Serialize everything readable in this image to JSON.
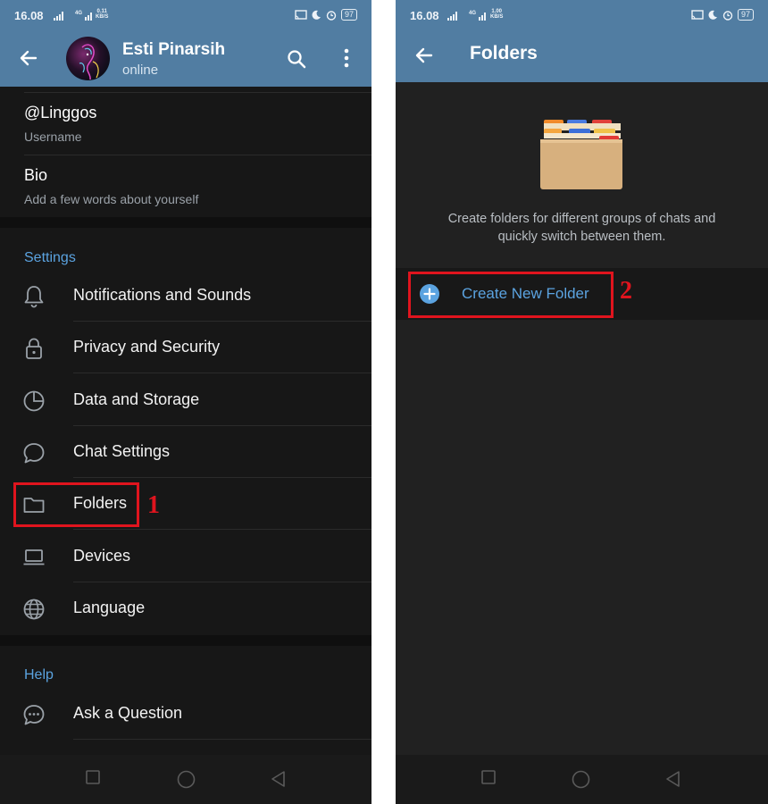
{
  "left": {
    "status": {
      "time": "16.08",
      "network": "4G",
      "speed_value": "0.11",
      "speed_unit": "KB/S",
      "battery": "97"
    },
    "header": {
      "name": "Esti Pinarsih",
      "status": "online"
    },
    "profile": {
      "username_value": "@Linggos",
      "username_label": "Username",
      "bio_value": "Bio",
      "bio_hint": "Add a few words about yourself"
    },
    "settings": {
      "title": "Settings",
      "items": [
        {
          "label": "Notifications and Sounds",
          "icon": "bell-icon"
        },
        {
          "label": "Privacy and Security",
          "icon": "lock-icon"
        },
        {
          "label": "Data and Storage",
          "icon": "pie-chart-icon"
        },
        {
          "label": "Chat Settings",
          "icon": "chat-bubble-icon"
        },
        {
          "label": "Folders",
          "icon": "folder-icon"
        },
        {
          "label": "Devices",
          "icon": "laptop-icon"
        },
        {
          "label": "Language",
          "icon": "globe-icon"
        }
      ]
    },
    "help": {
      "title": "Help",
      "items": [
        {
          "label": "Ask a Question",
          "icon": "question-bubble-icon"
        }
      ]
    },
    "annotation": "1"
  },
  "right": {
    "status": {
      "time": "16.08",
      "network": "4G",
      "speed_value": "1.00",
      "speed_unit": "KB/S",
      "battery": "97"
    },
    "header": {
      "title": "Folders"
    },
    "description": "Create folders for different groups of chats and quickly switch between them.",
    "create_button": "Create New Folder",
    "annotation": "2"
  },
  "colors": {
    "appbar": "#517da2",
    "accent": "#5ba3e0",
    "background": "#171717",
    "highlight": "#e0141e"
  }
}
